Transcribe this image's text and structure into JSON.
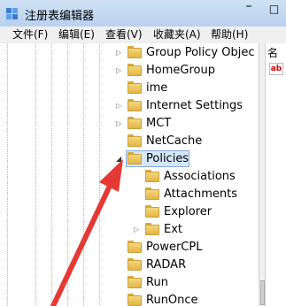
{
  "window": {
    "title": "注册表编辑器",
    "minimize_glyph": "–",
    "maximize_glyph": "□"
  },
  "menu": [
    {
      "label": "文件(F)"
    },
    {
      "label": "编辑(E)"
    },
    {
      "label": "查看(V)"
    },
    {
      "label": "收藏夹(A)"
    },
    {
      "label": "帮助(H)"
    }
  ],
  "tree": {
    "items": [
      {
        "label": "Group Policy Objec",
        "expander": "▷"
      },
      {
        "label": "HomeGroup",
        "expander": "▷"
      },
      {
        "label": "ime",
        "expander": ""
      },
      {
        "label": "Internet Settings",
        "expander": "▷"
      },
      {
        "label": "MCT",
        "expander": "▷"
      },
      {
        "label": "NetCache",
        "expander": ""
      },
      {
        "label": "Policies",
        "expander": "◢",
        "selected": true
      },
      {
        "label": "Associations",
        "expander": ""
      },
      {
        "label": "Attachments",
        "expander": ""
      },
      {
        "label": "Explorer",
        "expander": ""
      },
      {
        "label": "Ext",
        "expander": "▷"
      },
      {
        "label": "PowerCPL",
        "expander": ""
      },
      {
        "label": "RADAR",
        "expander": ""
      },
      {
        "label": "Run",
        "expander": ""
      },
      {
        "label": "RunOnce",
        "expander": ""
      }
    ]
  },
  "right_pane": {
    "column_header": "名",
    "value_icon_text": "ab"
  },
  "colors": {
    "selection": "#d5e7fa",
    "arrow": "#e53935",
    "folder": "#f5d77a"
  }
}
